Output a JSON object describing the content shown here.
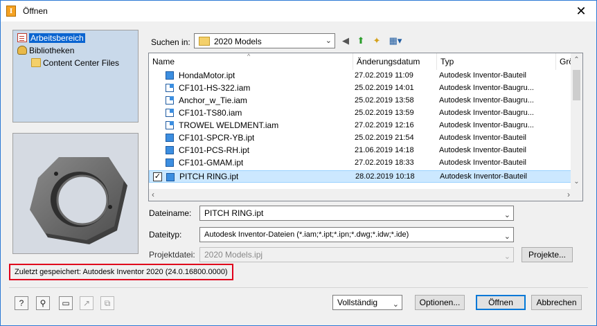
{
  "window": {
    "title": "Öffnen",
    "close": "✕"
  },
  "locations": [
    {
      "label": "Arbeitsbereich",
      "icon": "workspace-icon",
      "selected": true
    },
    {
      "label": "Bibliotheken",
      "icon": "library-icon",
      "selected": false
    },
    {
      "label": "Content Center Files",
      "icon": "folder-icon",
      "selected": false
    }
  ],
  "lookin": {
    "label": "Suchen in:",
    "value": "2020 Models"
  },
  "columns": {
    "name": "Name",
    "date": "Änderungsdatum",
    "type": "Typ",
    "size": "Grö"
  },
  "files": [
    {
      "name": "HondaMotor.ipt",
      "date": "27.02.2019 11:09",
      "type": "Autodesk Inventor-Bauteil",
      "kind": "ipt"
    },
    {
      "name": "CF101-HS-322.iam",
      "date": "25.02.2019 14:01",
      "type": "Autodesk Inventor-Baugru...",
      "kind": "iam"
    },
    {
      "name": "Anchor_w_Tie.iam",
      "date": "25.02.2019 13:58",
      "type": "Autodesk Inventor-Baugru...",
      "kind": "iam"
    },
    {
      "name": "CF101-TS80.iam",
      "date": "25.02.2019 13:59",
      "type": "Autodesk Inventor-Baugru...",
      "kind": "iam"
    },
    {
      "name": "TROWEL WELDMENT.iam",
      "date": "27.02.2019 12:16",
      "type": "Autodesk Inventor-Baugru...",
      "kind": "iam"
    },
    {
      "name": "CF101-SPCR-YB.ipt",
      "date": "25.02.2019 21:54",
      "type": "Autodesk Inventor-Bauteil",
      "kind": "ipt"
    },
    {
      "name": "CF101-PCS-RH.ipt",
      "date": "21.06.2019 14:18",
      "type": "Autodesk Inventor-Bauteil",
      "kind": "ipt"
    },
    {
      "name": "CF101-GMAM.ipt",
      "date": "27.02.2019 18:33",
      "type": "Autodesk Inventor-Bauteil",
      "kind": "ipt"
    },
    {
      "name": "PITCH RING.ipt",
      "date": "28.02.2019 10:18",
      "type": "Autodesk Inventor-Bauteil",
      "kind": "ipt",
      "selected": true
    }
  ],
  "form": {
    "filename_label": "Dateiname:",
    "filename_value": "PITCH RING.ipt",
    "filetype_label": "Dateityp:",
    "filetype_value": "Autodesk Inventor-Dateien (*.iam;*.ipt;*.ipn;*.dwg;*.idw;*.ide)",
    "project_label": "Projektdatei:",
    "project_value": "2020 Models.ipj",
    "projects_button": "Projekte..."
  },
  "saved_info": "Zuletzt gespeichert: Autodesk Inventor 2020 (24.0.16800.0000)",
  "footer": {
    "mode": "Vollständig",
    "options": "Optionen...",
    "open": "Öffnen",
    "cancel": "Abbrechen"
  },
  "colors": {
    "selection": "#0a64d0",
    "row_selection": "#cce8ff",
    "highlight_box": "#e0001b"
  }
}
